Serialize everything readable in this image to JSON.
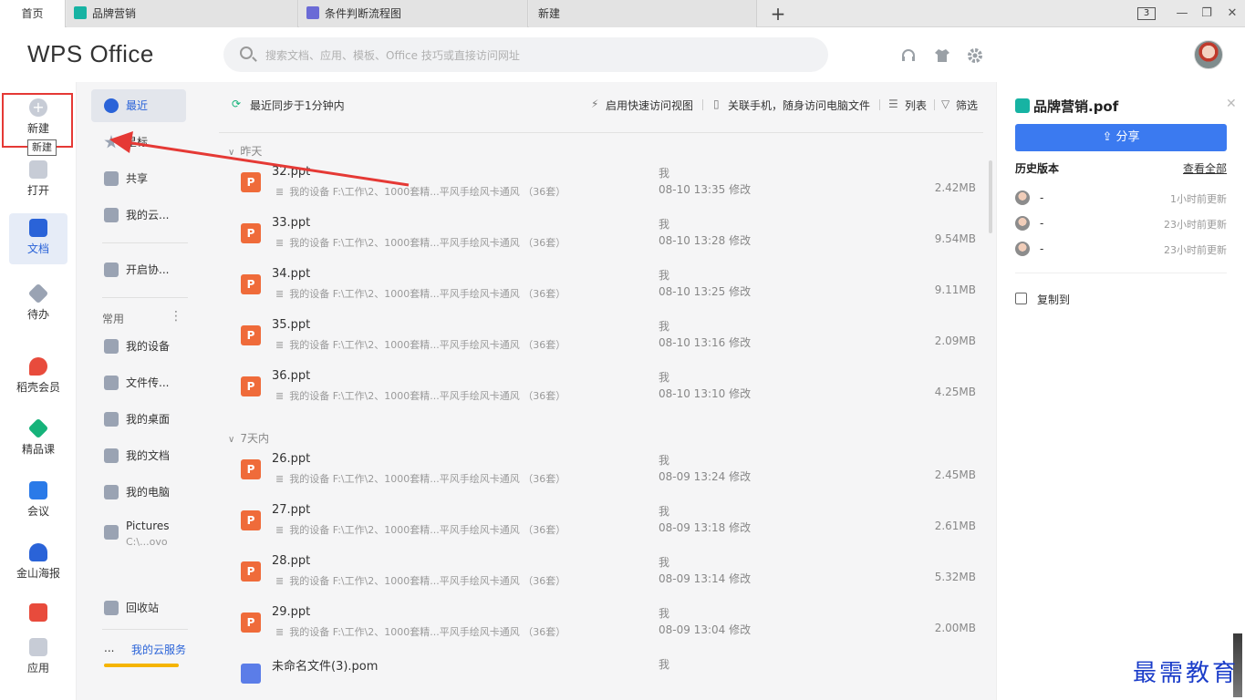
{
  "tabs": [
    {
      "label": "首页",
      "active": true
    },
    {
      "label": "品牌营销",
      "icon": "share-doc-icon",
      "icon_color": "#17b3a3"
    },
    {
      "label": "条件判断流程图",
      "icon": "flowchart-icon",
      "icon_color": "#6b6bd6"
    },
    {
      "label": "新建"
    }
  ],
  "tab_add": "+",
  "tab_count": "3",
  "window_controls": {
    "minimize": "—",
    "restore": "❐",
    "close": "✕"
  },
  "header": {
    "logo": "WPS Office",
    "search_placeholder": "搜索文档、应用、模板、Office 技巧或直接访问网址"
  },
  "left_nav": {
    "new": "新建",
    "tooltip": "新建",
    "open": "打开",
    "docs": "文档",
    "todo": "待办",
    "member": "稻壳会员",
    "course": "精品课",
    "meeting": "会议",
    "poster": "金山海报",
    "gift": "",
    "apps": "应用"
  },
  "sub_nav": {
    "recent": "最近",
    "star": "星标",
    "share": "共享",
    "cloud": "我的云...",
    "collab": "开启协...",
    "common_group": "常用",
    "dots": "⋮",
    "device": "我的设备",
    "transfer": "文件传...",
    "desktop": "我的桌面",
    "mydocs": "我的文档",
    "mypc": "我的电脑",
    "pictures": "Pictures",
    "pictures_path": "C:\\...ovo",
    "recycle": "回收站",
    "cloud_dots": "...",
    "cloud_service": "我的云服务"
  },
  "toolbar": {
    "sync": "最近同步于1分钟内",
    "quick_view": "启用快速访问视图",
    "phone": "关联手机，随身访问电脑文件",
    "list": "列表",
    "filter": "筛选"
  },
  "groups": {
    "yesterday": "昨天",
    "week": "7天内"
  },
  "files_yesterday": [
    {
      "name": "32.ppt",
      "path": "我的设备 F:\\工作\\2、1000套精...平风手绘风卡通风 （36套）",
      "owner": "我",
      "time": "08-10 13:35 修改",
      "size": "2.42MB"
    },
    {
      "name": "33.ppt",
      "path": "我的设备 F:\\工作\\2、1000套精...平风手绘风卡通风 （36套）",
      "owner": "我",
      "time": "08-10 13:28 修改",
      "size": "9.54MB"
    },
    {
      "name": "34.ppt",
      "path": "我的设备 F:\\工作\\2、1000套精...平风手绘风卡通风 （36套）",
      "owner": "我",
      "time": "08-10 13:25 修改",
      "size": "9.11MB"
    },
    {
      "name": "35.ppt",
      "path": "我的设备 F:\\工作\\2、1000套精...平风手绘风卡通风 （36套）",
      "owner": "我",
      "time": "08-10 13:16 修改",
      "size": "2.09MB"
    },
    {
      "name": "36.ppt",
      "path": "我的设备 F:\\工作\\2、1000套精...平风手绘风卡通风 （36套）",
      "owner": "我",
      "time": "08-10 13:10 修改",
      "size": "4.25MB"
    }
  ],
  "files_week": [
    {
      "name": "26.ppt",
      "path": "我的设备 F:\\工作\\2、1000套精...平风手绘风卡通风 （36套）",
      "owner": "我",
      "time": "08-09 13:24 修改",
      "size": "2.45MB"
    },
    {
      "name": "27.ppt",
      "path": "我的设备 F:\\工作\\2、1000套精...平风手绘风卡通风 （36套）",
      "owner": "我",
      "time": "08-09 13:18 修改",
      "size": "2.61MB"
    },
    {
      "name": "28.ppt",
      "path": "我的设备 F:\\工作\\2、1000套精...平风手绘风卡通风 （36套）",
      "owner": "我",
      "time": "08-09 13:14 修改",
      "size": "5.32MB"
    },
    {
      "name": "29.ppt",
      "path": "我的设备 F:\\工作\\2、1000套精...平风手绘风卡通风 （36套）",
      "owner": "我",
      "time": "08-09 13:04 修改",
      "size": "2.00MB"
    },
    {
      "name": "未命名文件(3).pom",
      "path": "",
      "owner": "我",
      "time": "",
      "size": ""
    }
  ],
  "file_icon_glyph": "P",
  "right_panel": {
    "title": "品牌营销.pof",
    "share": "分享",
    "history": "历史版本",
    "view_all": "查看全部",
    "versions": [
      {
        "name": "-",
        "time": "1小时前更新"
      },
      {
        "name": "-",
        "time": "23小时前更新"
      },
      {
        "name": "-",
        "time": "23小时前更新"
      }
    ],
    "copy_to": "复制到",
    "close": "✕"
  },
  "watermark": "最需教育",
  "colors": {
    "accent": "#3b7af0",
    "ppt": "#ef6b3a",
    "highlight_box": "#e53935"
  }
}
